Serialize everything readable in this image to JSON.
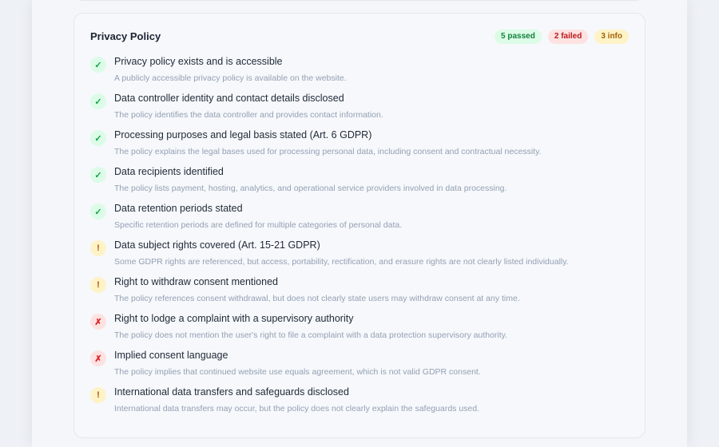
{
  "section": {
    "title": "Privacy Policy",
    "badges": {
      "passed": "5 passed",
      "failed": "2 failed",
      "info": "3 info"
    }
  },
  "status_icons": {
    "pass": "✓",
    "warn": "!",
    "fail": "✗"
  },
  "colors": {
    "pass": "#16a34a",
    "warn": "#b45309",
    "fail": "#dc2626"
  },
  "checks": [
    {
      "status": "pass",
      "icon": "check-icon",
      "title": "Privacy policy exists and is accessible",
      "description": "A publicly accessible privacy policy is available on the website."
    },
    {
      "status": "pass",
      "icon": "check-icon",
      "title": "Data controller identity and contact details disclosed",
      "description": "The policy identifies the data controller and provides contact information."
    },
    {
      "status": "pass",
      "icon": "check-icon",
      "title": "Processing purposes and legal basis stated (Art. 6 GDPR)",
      "description": "The policy explains the legal bases used for processing personal data, including consent and contractual necessity."
    },
    {
      "status": "pass",
      "icon": "check-icon",
      "title": "Data recipients identified",
      "description": "The policy lists payment, hosting, analytics, and operational service providers involved in data processing."
    },
    {
      "status": "pass",
      "icon": "check-icon",
      "title": "Data retention periods stated",
      "description": "Specific retention periods are defined for multiple categories of personal data."
    },
    {
      "status": "warn",
      "icon": "warning-icon",
      "title": "Data subject rights covered (Art. 15-21 GDPR)",
      "description": "Some GDPR rights are referenced, but access, portability, rectification, and erasure rights are not clearly listed individually."
    },
    {
      "status": "warn",
      "icon": "warning-icon",
      "title": "Right to withdraw consent mentioned",
      "description": "The policy references consent withdrawal, but does not clearly state users may withdraw consent at any time."
    },
    {
      "status": "fail",
      "icon": "cross-icon",
      "title": "Right to lodge a complaint with a supervisory authority",
      "description": "The policy does not mention the user's right to file a complaint with a data protection supervisory authority."
    },
    {
      "status": "fail",
      "icon": "cross-icon",
      "title": "Implied consent language",
      "description": "The policy implies that continued website use equals agreement, which is not valid GDPR consent."
    },
    {
      "status": "warn",
      "icon": "warning-icon",
      "title": "International data transfers and safeguards disclosed",
      "description": "International data transfers may occur, but the policy does not clearly explain the safeguards used."
    }
  ]
}
